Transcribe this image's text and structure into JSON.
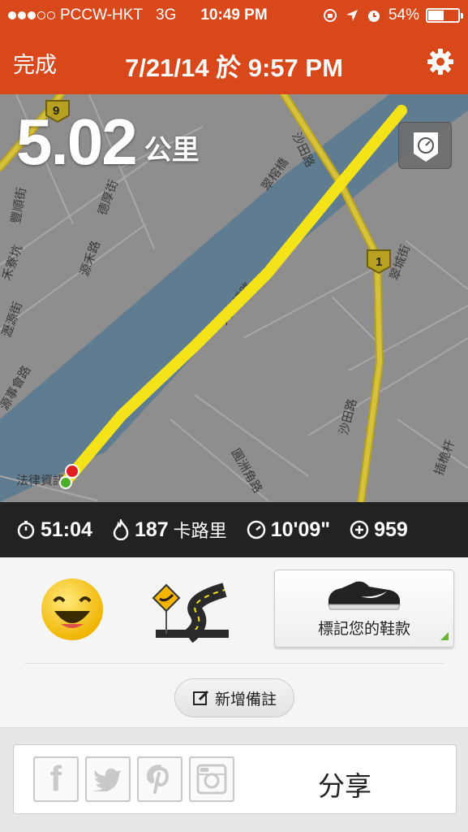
{
  "status_bar": {
    "carrier": "PCCW-HKT",
    "network": "3G",
    "time": "10:49 PM",
    "battery_text": "54%",
    "battery_level": 0.54,
    "signal_bars_filled": 3,
    "signal_bars_total": 5
  },
  "nav": {
    "done_label": "完成",
    "title": "7/21/14 於 9:57 PM",
    "settings_icon": "gear-icon"
  },
  "map": {
    "distance_value": "5.02",
    "distance_unit": "公里",
    "route_color": "#f5e31a",
    "labels": {
      "road_shatin": "沙田路",
      "road_shatin_2": "沙田路",
      "road_9": "9",
      "road_1": "1",
      "street_1": "豐順街",
      "street_2": "德厚街",
      "street_3": "禾寮坑",
      "street_4": "源禾路",
      "street_5": "瀝源街",
      "street_6": "圓洲角路",
      "street_7": "大涌橋路",
      "street_8": "翠榕橋",
      "street_9": "插桅杆",
      "street_10": "法律資訊",
      "street_11": "源事會路",
      "street_12": "翠城街"
    }
  },
  "stats": {
    "duration": "51:04",
    "calories_value": "187",
    "calories_unit": "卡路里",
    "pace": "10'09\"",
    "fuel": "959"
  },
  "feedback": {
    "shoe_label": "標記您的鞋款",
    "add_note_label": "新增備註"
  },
  "share": {
    "label": "分享",
    "facebook_glyph": "f"
  }
}
